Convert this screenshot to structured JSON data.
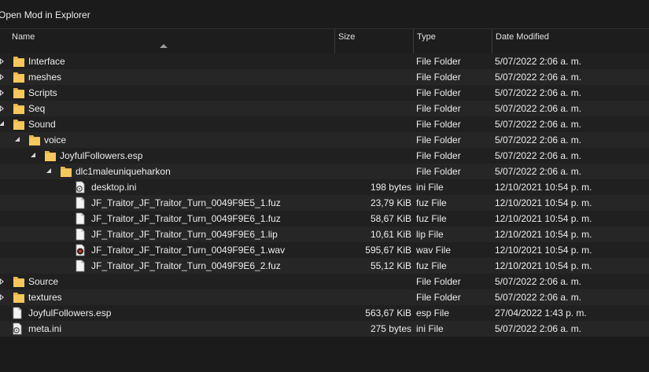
{
  "toolbar": {
    "open_label": "Open Mod in Explorer"
  },
  "columns": {
    "name": "Name",
    "size": "Size",
    "type": "Type",
    "date": "Date Modified"
  },
  "rows": [
    {
      "depth": 0,
      "kind": "folder",
      "expand": "closed",
      "name": "Interface",
      "size": "",
      "type": "File Folder",
      "date": "5/07/2022 2:06 a. m."
    },
    {
      "depth": 0,
      "kind": "folder",
      "expand": "closed",
      "name": "meshes",
      "size": "",
      "type": "File Folder",
      "date": "5/07/2022 2:06 a. m."
    },
    {
      "depth": 0,
      "kind": "folder",
      "expand": "closed",
      "name": "Scripts",
      "size": "",
      "type": "File Folder",
      "date": "5/07/2022 2:06 a. m."
    },
    {
      "depth": 0,
      "kind": "folder",
      "expand": "closed",
      "name": "Seq",
      "size": "",
      "type": "File Folder",
      "date": "5/07/2022 2:06 a. m."
    },
    {
      "depth": 0,
      "kind": "folder",
      "expand": "open",
      "name": "Sound",
      "size": "",
      "type": "File Folder",
      "date": "5/07/2022 2:06 a. m."
    },
    {
      "depth": 1,
      "kind": "folder",
      "expand": "open",
      "name": "voice",
      "size": "",
      "type": "File Folder",
      "date": "5/07/2022 2:06 a. m."
    },
    {
      "depth": 2,
      "kind": "folder",
      "expand": "open",
      "name": "JoyfulFollowers.esp",
      "size": "",
      "type": "File Folder",
      "date": "5/07/2022 2:06 a. m."
    },
    {
      "depth": 3,
      "kind": "folder",
      "expand": "open",
      "name": "dlc1maleuniqueharkon",
      "size": "",
      "type": "File Folder",
      "date": "5/07/2022 2:06 a. m."
    },
    {
      "depth": 4,
      "kind": "ini",
      "expand": "none",
      "name": "desktop.ini",
      "size": "198 bytes",
      "type": "ini File",
      "date": "12/10/2021 10:54 p. m."
    },
    {
      "depth": 4,
      "kind": "file",
      "expand": "none",
      "name": "JF_Traitor_JF_Traitor_Turn_0049F9E5_1.fuz",
      "size": "23,79 KiB",
      "type": "fuz File",
      "date": "12/10/2021 10:54 p. m."
    },
    {
      "depth": 4,
      "kind": "file",
      "expand": "none",
      "name": "JF_Traitor_JF_Traitor_Turn_0049F9E6_1.fuz",
      "size": "58,67 KiB",
      "type": "fuz File",
      "date": "12/10/2021 10:54 p. m."
    },
    {
      "depth": 4,
      "kind": "file",
      "expand": "none",
      "name": "JF_Traitor_JF_Traitor_Turn_0049F9E6_1.lip",
      "size": "10,61 KiB",
      "type": "lip File",
      "date": "12/10/2021 10:54 p. m."
    },
    {
      "depth": 4,
      "kind": "wav",
      "expand": "none",
      "name": "JF_Traitor_JF_Traitor_Turn_0049F9E6_1.wav",
      "size": "595,67 KiB",
      "type": "wav File",
      "date": "12/10/2021 10:54 p. m."
    },
    {
      "depth": 4,
      "kind": "file",
      "expand": "none",
      "name": "JF_Traitor_JF_Traitor_Turn_0049F9E6_2.fuz",
      "size": "55,12 KiB",
      "type": "fuz File",
      "date": "12/10/2021 10:54 p. m."
    },
    {
      "depth": 0,
      "kind": "folder",
      "expand": "closed",
      "name": "Source",
      "size": "",
      "type": "File Folder",
      "date": "5/07/2022 2:06 a. m."
    },
    {
      "depth": 0,
      "kind": "folder",
      "expand": "closed",
      "name": "textures",
      "size": "",
      "type": "File Folder",
      "date": "5/07/2022 2:06 a. m."
    },
    {
      "depth": 0,
      "kind": "file",
      "expand": "none",
      "name": "JoyfulFollowers.esp",
      "size": "563,67 KiB",
      "type": "esp File",
      "date": "27/04/2022 1:43 p. m."
    },
    {
      "depth": 0,
      "kind": "ini",
      "expand": "none",
      "name": "meta.ini",
      "size": "275 bytes",
      "type": "ini File",
      "date": "5/07/2022 2:06 a. m."
    }
  ]
}
